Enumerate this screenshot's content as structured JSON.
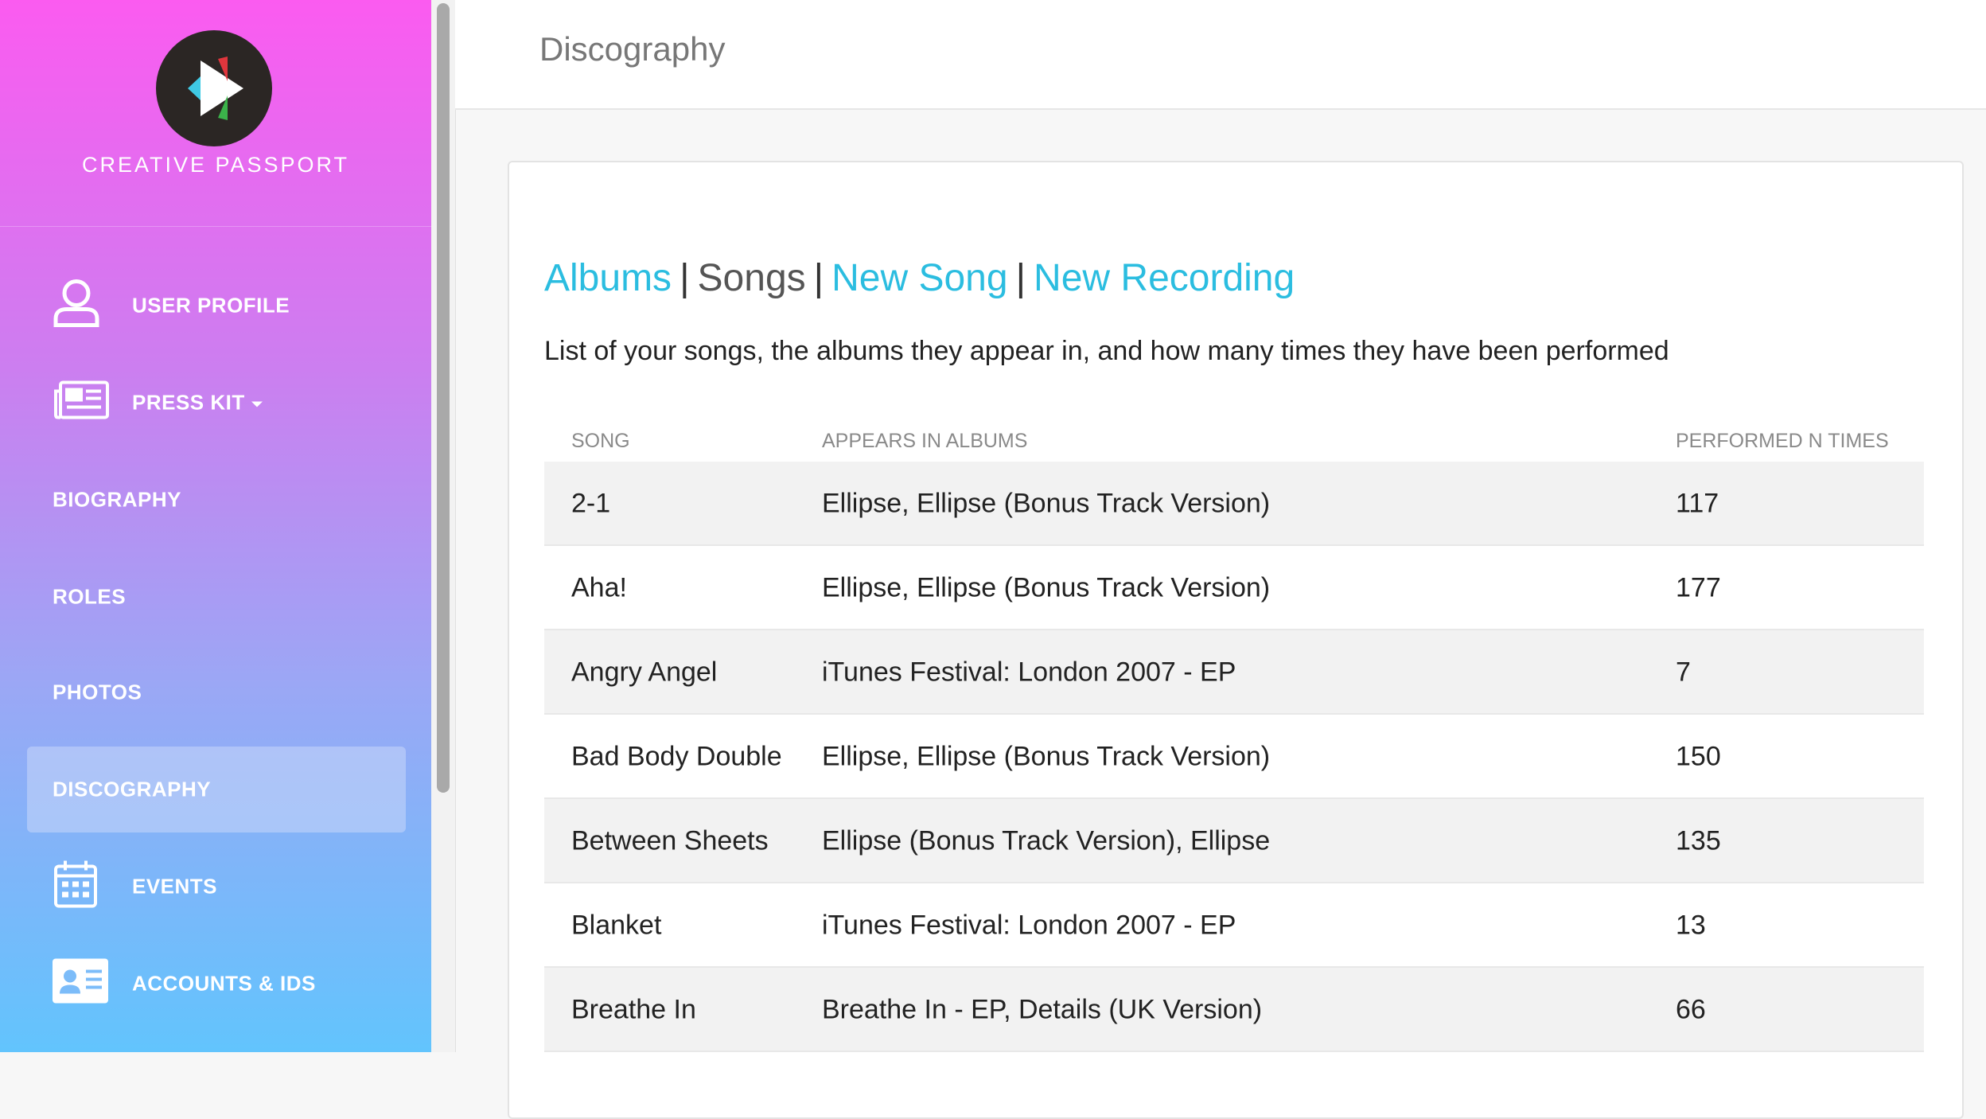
{
  "brand": {
    "name": "CREATIVE PASSPORT"
  },
  "sidebar": {
    "items": [
      {
        "label": "USER PROFILE",
        "icon": "user-icon"
      },
      {
        "label": "PRESS KIT",
        "icon": "newspaper-icon",
        "dropdown": true
      },
      {
        "label": "BIOGRAPHY"
      },
      {
        "label": "ROLES"
      },
      {
        "label": "PHOTOS"
      },
      {
        "label": "DISCOGRAPHY",
        "active": true
      },
      {
        "label": "EVENTS",
        "icon": "calendar-icon"
      },
      {
        "label": "ACCOUNTS & IDS",
        "icon": "id-card-icon"
      }
    ]
  },
  "header": {
    "title": "Discography"
  },
  "tabs": {
    "albums": "Albums",
    "songs": "Songs",
    "new_song": "New Song",
    "new_recording": "New Recording",
    "separator": "|"
  },
  "description": "List of your songs, the albums they appear in, and how many times they have been performed",
  "table": {
    "headers": [
      "SONG",
      "APPEARS IN ALBUMS",
      "PERFORMED N TIMES"
    ],
    "rows": [
      {
        "song": "2-1",
        "albums": "Ellipse, Ellipse (Bonus Track Version)",
        "performed": "117"
      },
      {
        "song": "Aha!",
        "albums": "Ellipse, Ellipse (Bonus Track Version)",
        "performed": "177"
      },
      {
        "song": "Angry Angel",
        "albums": "iTunes Festival: London 2007 - EP",
        "performed": "7"
      },
      {
        "song": "Bad Body Double",
        "albums": "Ellipse, Ellipse (Bonus Track Version)",
        "performed": "150"
      },
      {
        "song": "Between Sheets",
        "albums": "Ellipse (Bonus Track Version), Ellipse",
        "performed": "135"
      },
      {
        "song": "Blanket",
        "albums": "iTunes Festival: London 2007 - EP",
        "performed": "13"
      },
      {
        "song": "Breathe In",
        "albums": "Breathe In - EP, Details (UK Version)",
        "performed": "66"
      }
    ]
  },
  "colors": {
    "accent": "#2bbde0",
    "sidebar_top": "#fb5bf0",
    "sidebar_bottom": "#62c4fd"
  }
}
